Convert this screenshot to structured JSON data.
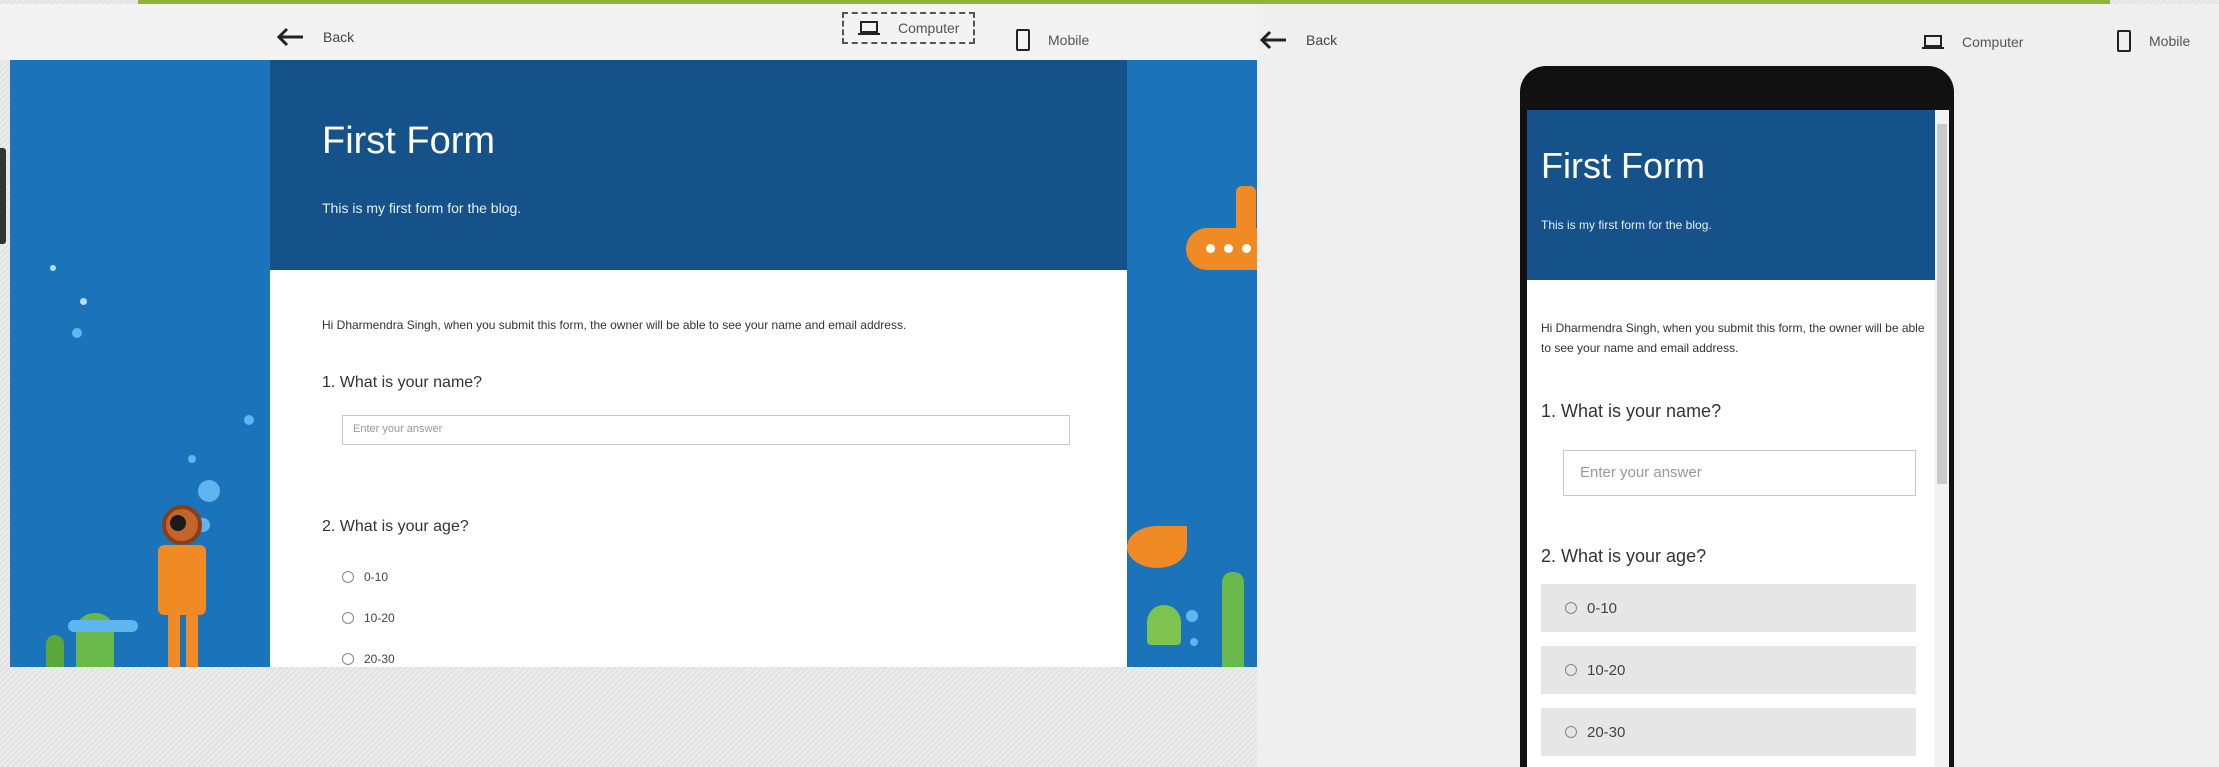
{
  "computer_view": {
    "back_label": "Back",
    "computer_label": "Computer",
    "mobile_label": "Mobile",
    "form": {
      "title": "First Form",
      "description": "This is my first form for the blog.",
      "notice": "Hi Dharmendra Singh, when you submit this form, the owner will be able to see your name and email address.",
      "q1": "1. What is your name?",
      "q1_placeholder": "Enter your answer",
      "q2": "2. What is your age?",
      "options": [
        "0-10",
        "10-20",
        "20-30"
      ]
    }
  },
  "mobile_view": {
    "back_label": "Back",
    "computer_label": "Computer",
    "mobile_label": "Mobile",
    "form": {
      "title": "First Form",
      "description": "This is my first form for the blog.",
      "notice": "Hi Dharmendra Singh, when you submit this form, the owner will be able to see your name and email address.",
      "q1": "1. What is your name?",
      "q1_placeholder": "Enter your answer",
      "q2": "2. What is your age?",
      "options": [
        "0-10",
        "10-20",
        "20-30"
      ]
    }
  },
  "icons": [
    "back-arrow-icon",
    "laptop-icon",
    "phone-icon",
    "radio-icon"
  ],
  "colors": {
    "header_blue": "#16528a",
    "background_blue": "#1b73ba",
    "accent_green": "#8fb43a"
  }
}
